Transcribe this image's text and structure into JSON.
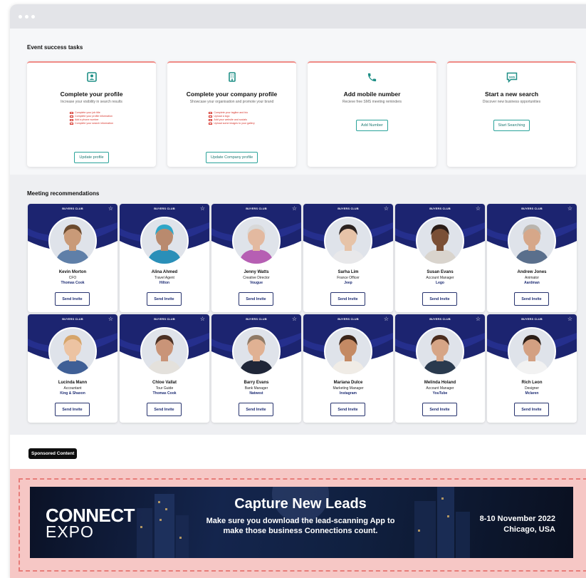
{
  "window": {
    "titlebar_dots": 3
  },
  "tasks": {
    "section_title": "Event success tasks",
    "cards": [
      {
        "icon": "profile-card-icon",
        "title": "Complete your profile",
        "subtitle": "Increase your visibility in search results",
        "checklist": [
          "Complete your job title",
          "Complete your profile information",
          "Add a phone number",
          "Complete your search information"
        ],
        "button": "Update profile"
      },
      {
        "icon": "building-icon",
        "title": "Complete your company profile",
        "subtitle": "Showcase your organisation and promote your brand",
        "checklist": [
          "Complete your tagline and bio",
          "Upload a logo",
          "Add your website and socials",
          "Upload some images to your gallery"
        ],
        "button": "Update Company profile"
      },
      {
        "icon": "phone-icon",
        "title": "Add mobile number",
        "subtitle": "Recieve free SMS meeting reminders",
        "checklist": [],
        "button": "Add Number"
      },
      {
        "icon": "chat-sms-icon",
        "title": "Start a new search",
        "subtitle": "Discover new business opportunities",
        "checklist": [],
        "button": "Start Searching"
      }
    ]
  },
  "recommendations": {
    "section_title": "Meeting recommendations",
    "banner_label": "BUYERS CLUB",
    "button_label": "Send Invite",
    "people": [
      {
        "name": "Kevin Morton",
        "role": "CFO",
        "company": "Thomas Cook",
        "skin": "#c99a78",
        "hair": "#6b4a2e",
        "shirt": "#5f7fa8"
      },
      {
        "name": "Alina Ahmed",
        "role": "Travel Agent",
        "company": "Hilton",
        "skin": "#b98a6e",
        "hair": "#2fa6c7",
        "shirt": "#2a8fb8"
      },
      {
        "name": "Jenny Watts",
        "role": "Creative Director",
        "company": "Vougue",
        "skin": "#e3b9a0",
        "hair": "#d8d8d8",
        "shirt": "#b65fb3"
      },
      {
        "name": "Sarha Lim",
        "role": "France Officer",
        "company": "Jeep",
        "skin": "#e6c3a8",
        "hair": "#2b2220",
        "shirt": "#e8e8ea"
      },
      {
        "name": "Susan Evans",
        "role": "Account Manager",
        "company": "Lego",
        "skin": "#7a4f36",
        "hair": "#2a1c16",
        "shirt": "#d9d4cd"
      },
      {
        "name": "Andrew Jones",
        "role": "Animator",
        "company": "Aardman",
        "skin": "#d6a789",
        "hair": "#b9b4ad",
        "shirt": "#5a6f8c"
      },
      {
        "name": "Lucinda Mann",
        "role": "Accountant",
        "company": "King & Shaxon",
        "skin": "#ecc3a2",
        "hair": "#d6a56a",
        "shirt": "#3f5f96"
      },
      {
        "name": "Chloe Vallat",
        "role": "Tour Guide",
        "company": "Thomas Cook",
        "skin": "#c99478",
        "hair": "#4a3024",
        "shirt": "#e4e1dc"
      },
      {
        "name": "Barry Evans",
        "role": "Bank Manager",
        "company": "Natwest",
        "skin": "#e0b193",
        "hair": "#8f7a66",
        "shirt": "#1f2638"
      },
      {
        "name": "Mariana Dulce",
        "role": "Marketing Manager",
        "company": "Instagram",
        "skin": "#c48a64",
        "hair": "#3a2418",
        "shirt": "#f0ece6"
      },
      {
        "name": "Melinda Holand",
        "role": "Account Manager",
        "company": "YouTube",
        "skin": "#d6a586",
        "hair": "#4b2d1e",
        "shirt": "#2a3a4e"
      },
      {
        "name": "Rich Leon",
        "role": "Designer",
        "company": "Mclaren",
        "skin": "#d3a082",
        "hair": "#2a1d16",
        "shirt": "#f2f2f2"
      }
    ]
  },
  "sponsored": {
    "badge": "Sponsored Content",
    "ad": {
      "brand_line1": "CONNECT",
      "brand_line2": "EXPO",
      "headline": "Capture New Leads",
      "body": "Make sure you download the lead-scanning App to make those business Connections count.",
      "date": "8-10 November 2022",
      "location": "Chicago, USA"
    }
  },
  "colors": {
    "accent_teal": "#2aa39a",
    "card_top_border": "#f08b86",
    "banner_navy": "#1c2470",
    "checklist_red": "#d6332a",
    "ad_zone_pink": "#f6c7c5"
  }
}
